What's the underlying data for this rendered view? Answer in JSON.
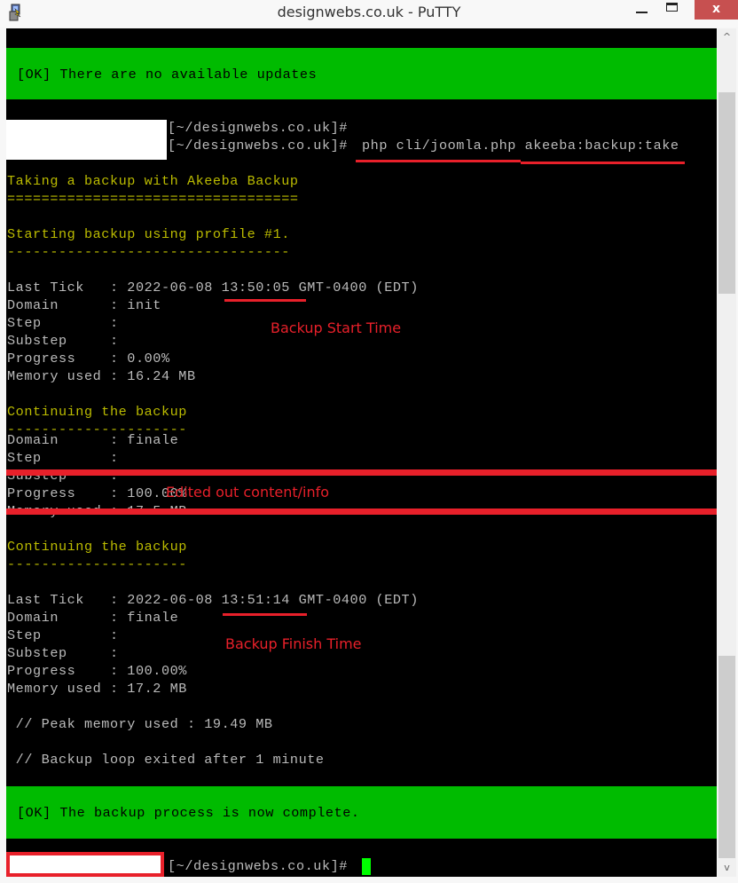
{
  "window": {
    "title": "designwebs.co.uk - PuTTY",
    "app_icon": "putty-icon",
    "controls": {
      "minimize": "minimize",
      "maximize": "maximize",
      "close": "x"
    }
  },
  "colors": {
    "terminal_bg": "#000000",
    "terminal_fg": "#bbbbbb",
    "heading_yellow": "#bbbb00",
    "ok_banner": "#00bb00",
    "cursor": "#00ff00",
    "annotation_red": "#e8202a"
  },
  "terminal": {
    "banner_top": "[OK] There are no available updates",
    "prompt1": "[~/designwebs.co.uk]#",
    "prompt2": "[~/designwebs.co.uk]#",
    "command": "php cli/joomla.php akeeba:backup:take",
    "heading1": "Taking a backup with Akeeba Backup",
    "heading1_rule": "==================================",
    "heading2": "Starting backup using profile #1.",
    "heading2_rule": "---------------------------------",
    "tick1": {
      "last_tick": "Last Tick   : 2022-06-08 13:50:05 GMT-0400 (EDT)",
      "domain": "Domain      : init",
      "step": "Step        :",
      "substep": "Substep     :",
      "progress": "Progress    : 0.00%",
      "memory": "Memory used : 16.24 MB"
    },
    "continuing1": "Continuing the backup",
    "continuing1_rule": "---------------------",
    "tick_partial": {
      "domain": "Domain      : finale",
      "step": "Step        :",
      "substep": "Substep     :",
      "progress": "Progress    : 100.00%",
      "memory": "Memory used : 17.5 MB"
    },
    "continuing2": "Continuing the backup",
    "continuing2_rule": "---------------------",
    "tick2": {
      "last_tick": "Last Tick   : 2022-06-08 13:51:14 GMT-0400 (EDT)",
      "domain": "Domain      : finale",
      "step": "Step        :",
      "substep": "Substep     :",
      "progress": "Progress    : 100.00%",
      "memory": "Memory used : 17.2 MB"
    },
    "peak_memory": " // Peak memory used : 19.49 MB",
    "loop_exit": " // Backup loop exited after 1 minute",
    "banner_bottom": "[OK] The backup process is now complete.",
    "prompt_final": "[~/designwebs.co.uk]#"
  },
  "annotations": {
    "start_time": "Backup Start Time",
    "finish_time": "Backup Finish Time",
    "edited_out": "Edited out content/info"
  },
  "scrollbar": {
    "up_arrow": "^",
    "down_arrow": "v"
  }
}
